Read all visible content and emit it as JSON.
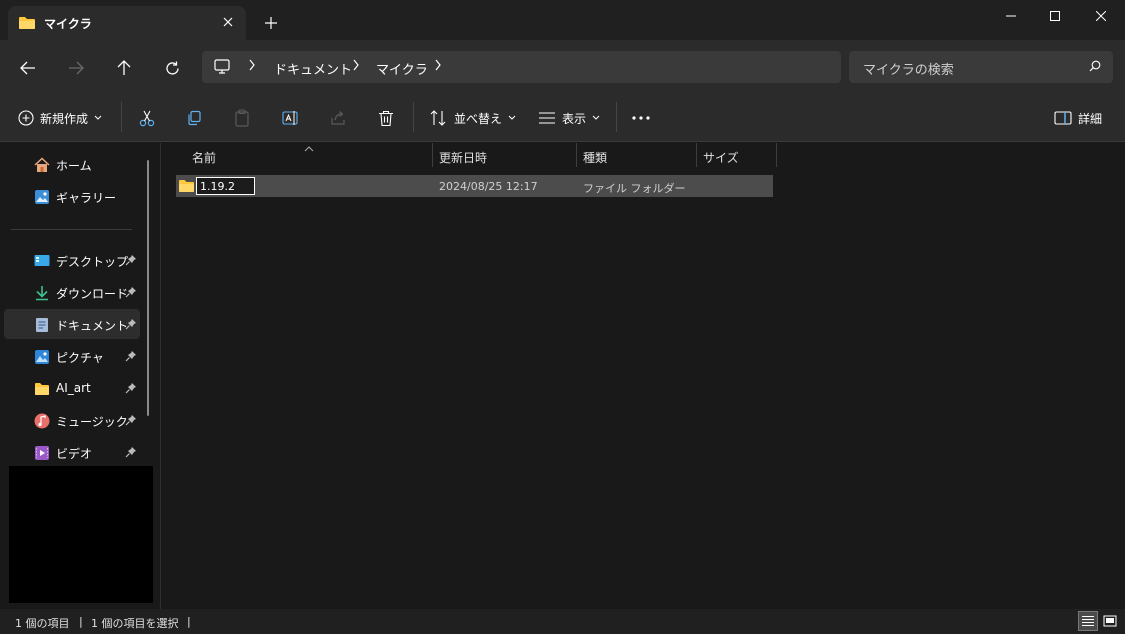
{
  "tab": {
    "title": "マイクラ"
  },
  "window": {
    "colors": {
      "accent": "#ffc83d"
    }
  },
  "address": {
    "crumbs": [
      "ドキュメント",
      "マイクラ"
    ]
  },
  "search": {
    "placeholder": "マイクラの検索"
  },
  "toolbar": {
    "new_label": "新規作成",
    "sort_label": "並べ替え",
    "view_label": "表示",
    "details_label": "詳細"
  },
  "sidebar": {
    "items": [
      {
        "label": "ホーム",
        "icon": "home-icon"
      },
      {
        "label": "ギャラリー",
        "icon": "gallery-icon"
      },
      {
        "label": "デスクトップ",
        "icon": "desktop-icon"
      },
      {
        "label": "ダウンロード",
        "icon": "download-icon"
      },
      {
        "label": "ドキュメント",
        "icon": "document-icon"
      },
      {
        "label": "ピクチャ",
        "icon": "pictures-icon"
      },
      {
        "label": "AI_art",
        "icon": "folder-icon"
      },
      {
        "label": "ミュージック",
        "icon": "music-icon"
      },
      {
        "label": "ビデオ",
        "icon": "video-icon"
      }
    ]
  },
  "columns": {
    "name": "名前",
    "modified": "更新日時",
    "type": "種類",
    "size": "サイズ"
  },
  "files": [
    {
      "name": "1.19.2",
      "modified": "2024/08/25 12:17",
      "type": "ファイル フォルダー"
    }
  ],
  "status": {
    "count": "1 個の項目",
    "selected": "1 個の項目を選択"
  }
}
